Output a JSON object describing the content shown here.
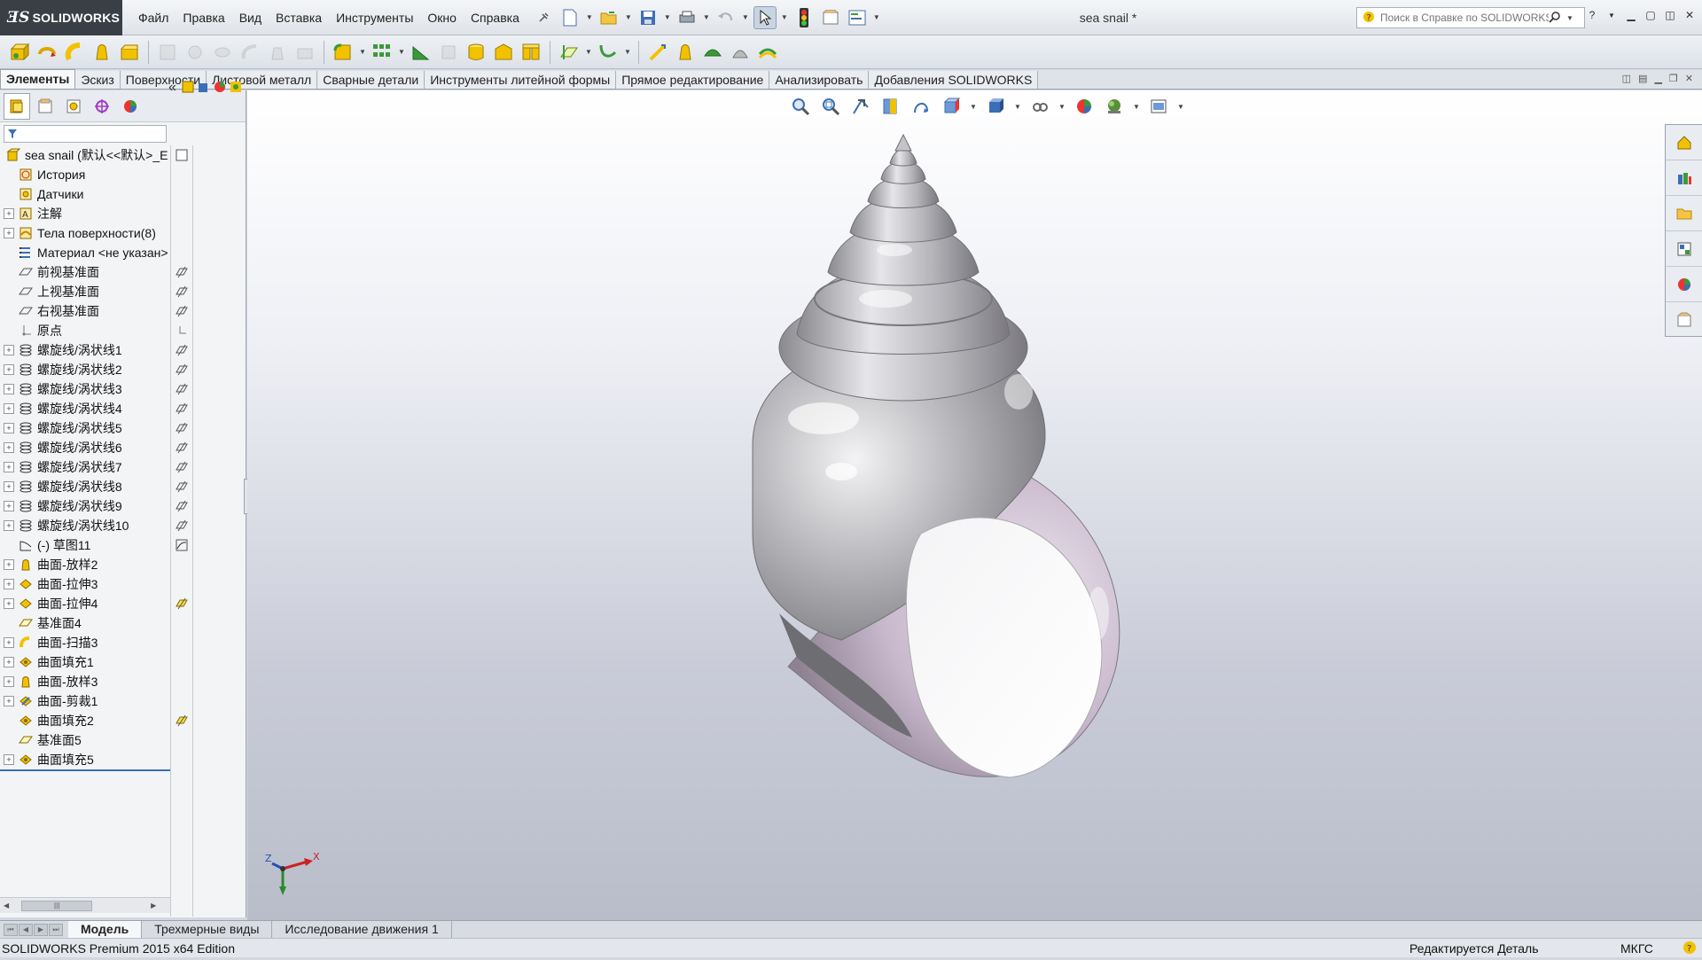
{
  "app": {
    "brand": "SOLIDWORKS",
    "document_title": "sea snail *"
  },
  "menu": [
    "Файл",
    "Правка",
    "Вид",
    "Вставка",
    "Инструменты",
    "Окно",
    "Справка"
  ],
  "search": {
    "placeholder": "Поиск в Справке по SOLIDWORKS"
  },
  "command_tabs": [
    {
      "label": "Элементы",
      "active": true
    },
    {
      "label": "Эскиз"
    },
    {
      "label": "Поверхности"
    },
    {
      "label": "Листовой металл"
    },
    {
      "label": "Сварные детали"
    },
    {
      "label": "Инструменты литейной формы"
    },
    {
      "label": "Прямое редактирование"
    },
    {
      "label": "Анализировать"
    },
    {
      "label": "Добавления SOLIDWORKS"
    }
  ],
  "feature_tree": {
    "root": "sea snail  (默认<<默认>_E",
    "items": [
      {
        "label": "История",
        "icon": "history-icon",
        "expandable": false
      },
      {
        "label": "Датчики",
        "icon": "sensors-icon",
        "expandable": false
      },
      {
        "label": "注解",
        "icon": "annotations-icon",
        "expandable": true
      },
      {
        "label": "Тела поверхности(8)",
        "icon": "surface-bodies-icon",
        "expandable": true
      },
      {
        "label": "Материал <не указан>",
        "icon": "material-icon",
        "expandable": false
      },
      {
        "label": "前视基准面",
        "icon": "plane-icon",
        "expandable": false,
        "mark": "plane"
      },
      {
        "label": "上视基准面",
        "icon": "plane-icon",
        "expandable": false,
        "mark": "plane"
      },
      {
        "label": "右视基准面",
        "icon": "plane-icon",
        "expandable": false,
        "mark": "plane"
      },
      {
        "label": "原点",
        "icon": "origin-icon",
        "expandable": false,
        "mark": "origin"
      },
      {
        "label": "螺旋线/涡状线1",
        "icon": "helix-icon",
        "expandable": true,
        "mark": "plane"
      },
      {
        "label": "螺旋线/涡状线2",
        "icon": "helix-icon",
        "expandable": true,
        "mark": "plane"
      },
      {
        "label": "螺旋线/涡状线3",
        "icon": "helix-icon",
        "expandable": true,
        "mark": "plane"
      },
      {
        "label": "螺旋线/涡状线4",
        "icon": "helix-icon",
        "expandable": true,
        "mark": "plane"
      },
      {
        "label": "螺旋线/涡状线5",
        "icon": "helix-icon",
        "expandable": true,
        "mark": "plane"
      },
      {
        "label": "螺旋线/涡状线6",
        "icon": "helix-icon",
        "expandable": true,
        "mark": "plane"
      },
      {
        "label": "螺旋线/涡状线7",
        "icon": "helix-icon",
        "expandable": true,
        "mark": "plane"
      },
      {
        "label": "螺旋线/涡状线8",
        "icon": "helix-icon",
        "expandable": true,
        "mark": "plane"
      },
      {
        "label": "螺旋线/涡状线9",
        "icon": "helix-icon",
        "expandable": true,
        "mark": "plane"
      },
      {
        "label": "螺旋线/涡状线10",
        "icon": "helix-icon",
        "expandable": true,
        "mark": "plane"
      },
      {
        "label": "(-) 草图11",
        "icon": "sketch-icon",
        "expandable": false,
        "mark": "sketch"
      },
      {
        "label": "曲面-放样2",
        "icon": "loft-icon",
        "expandable": true
      },
      {
        "label": "曲面-拉伸3",
        "icon": "extrude-icon",
        "expandable": true
      },
      {
        "label": "曲面-拉伸4",
        "icon": "extrude-icon",
        "expandable": true,
        "mark": "yplane"
      },
      {
        "label": "基准面4",
        "icon": "ref-plane-icon",
        "expandable": false
      },
      {
        "label": "曲面-扫描3",
        "icon": "sweep-icon",
        "expandable": true
      },
      {
        "label": "曲面填充1",
        "icon": "fill-icon",
        "expandable": true
      },
      {
        "label": "曲面-放样3",
        "icon": "loft-icon",
        "expandable": true
      },
      {
        "label": "曲面-剪裁1",
        "icon": "trim-icon",
        "expandable": true
      },
      {
        "label": "曲面填充2",
        "icon": "fill-icon",
        "expandable": false,
        "mark": "yplane"
      },
      {
        "label": "基准面5",
        "icon": "ref-plane-icon",
        "expandable": false
      },
      {
        "label": "曲面填充5",
        "icon": "fill-icon",
        "expandable": true
      }
    ]
  },
  "bottom_tabs": [
    {
      "label": "Модель",
      "active": true
    },
    {
      "label": "Трехмерные виды"
    },
    {
      "label": "Исследование движения 1"
    }
  ],
  "status": {
    "left": "SOLIDWORKS Premium 2015 x64 Edition",
    "right": "Редактируется Деталь",
    "units": "МКГС"
  },
  "triad": {
    "x": "X",
    "y": "Y",
    "z": "Z"
  },
  "colors": {
    "accent": "#3b6fb6",
    "feature_yellow": "#f2c200",
    "brand_bg": "#3a3f46"
  }
}
